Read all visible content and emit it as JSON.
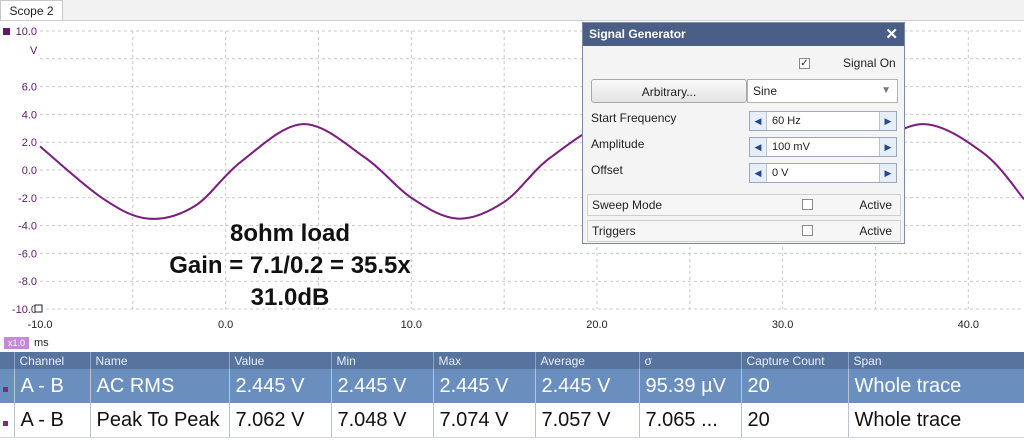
{
  "tab": {
    "label": "Scope 2"
  },
  "plot": {
    "y_unit": "V",
    "y_ticks": [
      "10.0",
      "6.0",
      "4.0",
      "2.0",
      "0.0",
      "-2.0",
      "-4.0",
      "-6.0",
      "-8.0",
      "-10.0"
    ],
    "x_ticks": [
      "-10.0",
      "0.0",
      "10.0",
      "20.0",
      "30.0",
      "40.0"
    ],
    "x_unit": "ms",
    "x_zoom": "x1.0",
    "trace_color": "#7a1f7f",
    "ghost_color": "#e6c9e3"
  },
  "chart_data": {
    "type": "line",
    "xlabel": "ms",
    "ylabel": "V",
    "xlim": [
      -10,
      43
    ],
    "ylim": [
      -10,
      10
    ],
    "series": [
      {
        "x": [
          -10,
          -6.67,
          -4.17,
          -1.67,
          0.83,
          4.17,
          7.5,
          10,
          12.5,
          15,
          17.5,
          20.83,
          24.17,
          26.67,
          29.17,
          31.67,
          34.17,
          37.5,
          40.83,
          43
        ],
        "values": [
          1.7,
          -2.0,
          -3.5,
          -2.6,
          0.6,
          3.3,
          0.9,
          -2.0,
          -3.5,
          -2.3,
          0.9,
          3.3,
          0.9,
          -2.0,
          -3.5,
          -2.3,
          0.9,
          3.3,
          1.2,
          -2.1
        ]
      }
    ]
  },
  "overlay": {
    "line1": "8ohm load",
    "line2": "Gain = 7.1/0.2 = 35.5x",
    "line3": "31.0dB"
  },
  "signal_generator": {
    "title": "Signal Generator",
    "close": "✕",
    "signal_on_label": "Signal On",
    "signal_on_checked": true,
    "arbitrary_button": "Arbitrary...",
    "waveform": "Sine",
    "start_frequency_label": "Start Frequency",
    "start_frequency": "60 Hz",
    "amplitude_label": "Amplitude",
    "amplitude": "100 mV",
    "offset_label": "Offset",
    "offset": "0 V",
    "sweep_mode_label": "Sweep Mode",
    "sweep_active_label": "Active",
    "triggers_label": "Triggers",
    "triggers_active_label": "Active"
  },
  "measurements": {
    "headers": [
      "Channel",
      "Name",
      "Value",
      "Min",
      "Max",
      "Average",
      "σ",
      "Capture Count",
      "Span"
    ],
    "rows": [
      [
        "A - B",
        "AC RMS",
        "2.445 V",
        "2.445 V",
        "2.445 V",
        "2.445 V",
        "95.39 µV",
        "20",
        "Whole trace"
      ],
      [
        "A - B",
        "Peak To Peak",
        "7.062 V",
        "7.048 V",
        "7.074 V",
        "7.057 V",
        "7.065 ...",
        "20",
        "Whole trace"
      ]
    ]
  }
}
